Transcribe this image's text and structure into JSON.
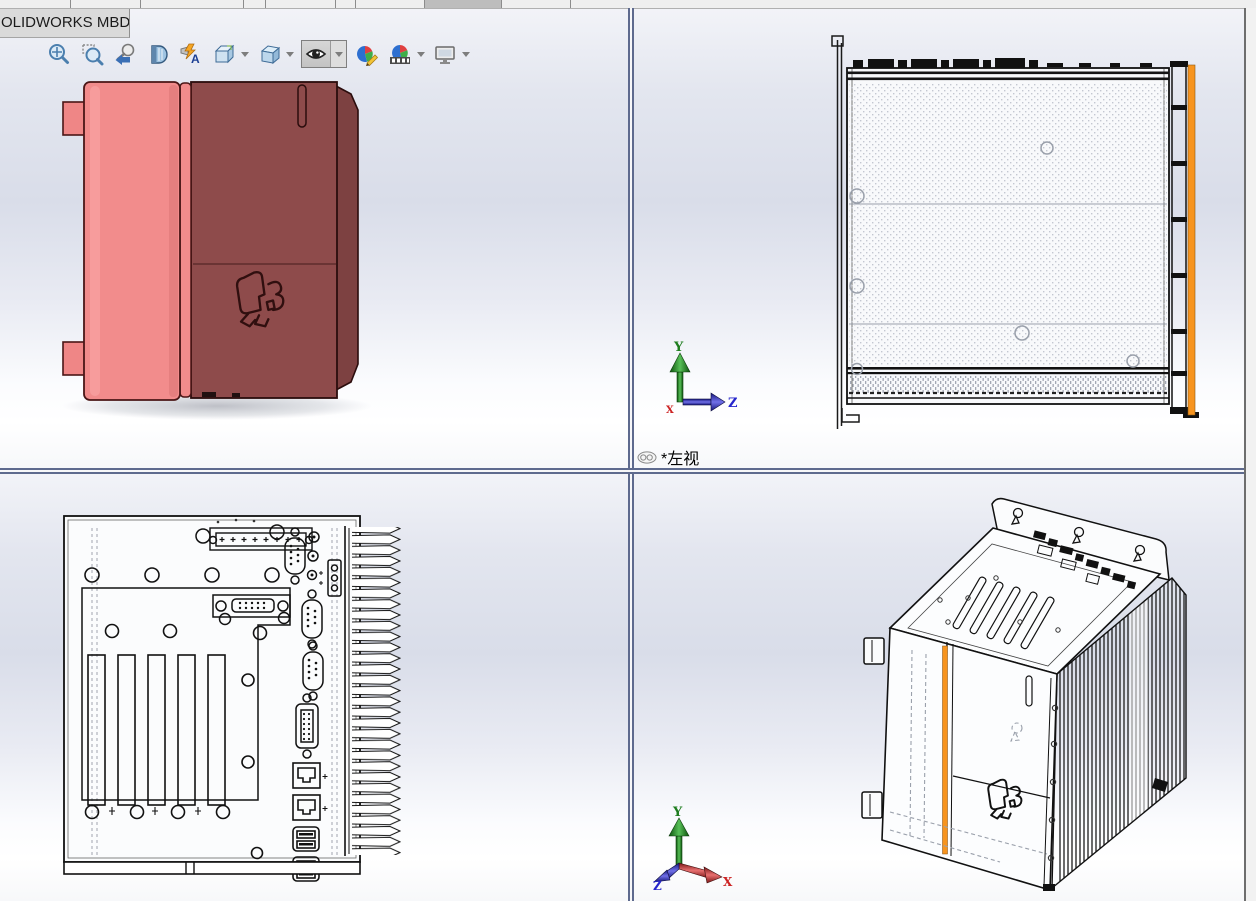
{
  "window": {
    "tab_title": "OLIDWORKS MBD"
  },
  "toolbar": {
    "icons": [
      {
        "name": "zoom-to-fit",
        "dropdown": false
      },
      {
        "name": "zoom-to-area",
        "dropdown": false
      },
      {
        "name": "previous-view",
        "dropdown": false
      },
      {
        "name": "section-view",
        "dropdown": false
      },
      {
        "name": "3d-drawing-view",
        "dropdown": false
      },
      {
        "name": "view-orientation",
        "dropdown": true
      },
      {
        "name": "display-style",
        "dropdown": true
      },
      {
        "name": "hide-show-items",
        "dropdown": true,
        "pressed": true
      },
      {
        "name": "edit-appearance",
        "dropdown": false
      },
      {
        "name": "apply-scene",
        "dropdown": true
      },
      {
        "name": "view-settings",
        "dropdown": true
      }
    ]
  },
  "viewports": {
    "top_left": {
      "name": "shaded-front-view"
    },
    "top_right": {
      "name": "left-wireframe-view",
      "label": "*左视",
      "badge": "3d-view-badge"
    },
    "bottom_left": {
      "name": "rear-wireframe-view"
    },
    "bottom_right": {
      "name": "isometric-wireframe-view"
    }
  },
  "triads": {
    "top_right": {
      "axes": [
        {
          "label": "Y",
          "color": "#1e7d1e"
        },
        {
          "label": "Z",
          "color": "#2626cc"
        },
        {
          "label": "X",
          "color": "#cc2222"
        }
      ]
    },
    "bottom_right": {
      "axes": [
        {
          "label": "Y",
          "color": "#1e7d1e"
        },
        {
          "label": "X",
          "color": "#cc2222"
        },
        {
          "label": "Z",
          "color": "#2626cc"
        }
      ]
    }
  },
  "colors": {
    "accent_orange": "#F7941E",
    "model_salmon": "#F28C8C",
    "model_maroon": "#8E4B4B",
    "model_maroon_dark": "#7D4141",
    "divider": "#5E6A8E",
    "background_top": "#E3E6EF",
    "background_bottom": "#FBFCFE"
  }
}
